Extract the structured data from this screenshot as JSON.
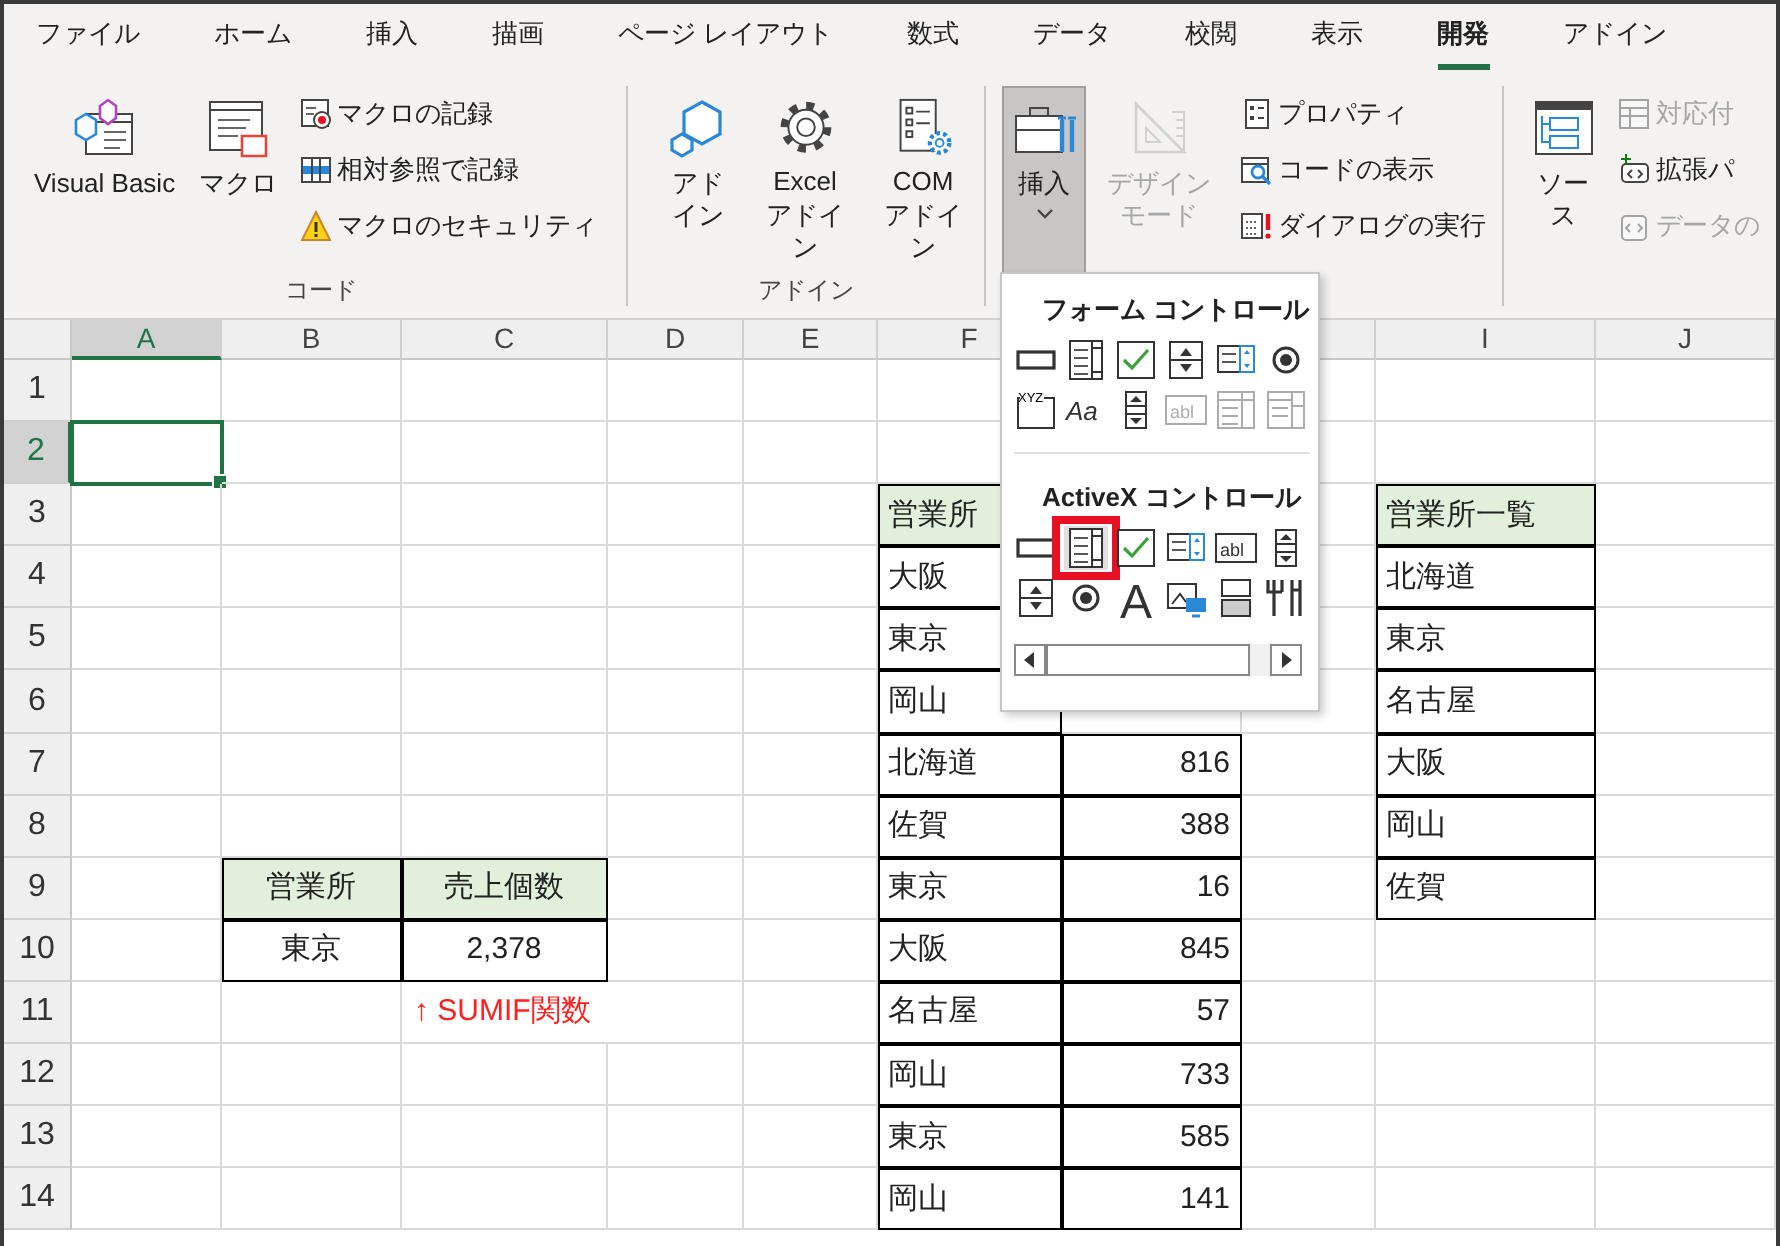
{
  "tabs": [
    {
      "label": "ファイル",
      "selected": false
    },
    {
      "label": "ホーム",
      "selected": false
    },
    {
      "label": "挿入",
      "selected": false
    },
    {
      "label": "描画",
      "selected": false
    },
    {
      "label": "ページ レイアウト",
      "selected": false
    },
    {
      "label": "数式",
      "selected": false
    },
    {
      "label": "データ",
      "selected": false
    },
    {
      "label": "校閲",
      "selected": false
    },
    {
      "label": "表示",
      "selected": false
    },
    {
      "label": "開発",
      "selected": true
    },
    {
      "label": "アドイン",
      "selected": false
    }
  ],
  "ribbon": {
    "groups": [
      {
        "label": "コード",
        "buttons": [
          {
            "kind": "large",
            "label": "Visual Basic",
            "pressed": false,
            "disabled": false,
            "dropdown": false
          },
          {
            "kind": "large",
            "label": "マクロ",
            "pressed": false,
            "disabled": false,
            "dropdown": false
          },
          {
            "kind": "small",
            "label": "マクロの記録",
            "pressed": false,
            "disabled": false
          },
          {
            "kind": "small",
            "label": "相対参照で記録",
            "pressed": false,
            "disabled": false
          },
          {
            "kind": "small",
            "label": "マクロのセキュリティ",
            "pressed": false,
            "disabled": false
          }
        ]
      },
      {
        "label": "アドイン",
        "buttons": [
          {
            "kind": "large",
            "label": "アドイン",
            "pressed": false,
            "disabled": false,
            "dropdown": false
          },
          {
            "kind": "large",
            "label": "Excel アドイン",
            "pressed": false,
            "disabled": false,
            "dropdown": false
          },
          {
            "kind": "large",
            "label": "COM アドイン",
            "pressed": false,
            "disabled": false,
            "dropdown": false
          }
        ]
      },
      {
        "buttons": [
          {
            "kind": "large",
            "label": "挿入",
            "pressed": true,
            "disabled": false,
            "dropdown": true
          },
          {
            "kind": "large",
            "label": "デザインモード",
            "pressed": false,
            "disabled": true,
            "dropdown": false
          },
          {
            "kind": "small",
            "label": "プロパティ",
            "pressed": false,
            "disabled": false
          },
          {
            "kind": "small",
            "label": "コードの表示",
            "pressed": false,
            "disabled": false
          },
          {
            "kind": "small",
            "label": "ダイアログの実行",
            "pressed": false,
            "disabled": false
          }
        ]
      },
      {
        "buttons": [
          {
            "kind": "large",
            "label": "ソース",
            "pressed": false,
            "disabled": false,
            "dropdown": false
          },
          {
            "kind": "small",
            "label": "対応付",
            "pressed": false,
            "disabled": true
          },
          {
            "kind": "small",
            "label": "拡張パ",
            "pressed": false,
            "disabled": false
          },
          {
            "kind": "small",
            "label": "データの",
            "pressed": false,
            "disabled": true
          }
        ]
      }
    ]
  },
  "insert_menu": {
    "sections": [
      {
        "title": "フォーム コントロール",
        "items": [
          {
            "kind": "button",
            "disabled": false,
            "highlighted": false
          },
          {
            "kind": "combobox",
            "disabled": false,
            "highlighted": false
          },
          {
            "kind": "checkbox",
            "disabled": false,
            "highlighted": false
          },
          {
            "kind": "spin",
            "disabled": false,
            "highlighted": false
          },
          {
            "kind": "listbox",
            "disabled": false,
            "highlighted": false
          },
          {
            "kind": "radio",
            "disabled": false,
            "highlighted": false
          },
          {
            "kind": "groupbox",
            "glyph": "XYZ",
            "disabled": false,
            "highlighted": false
          },
          {
            "kind": "label",
            "glyph": "Aa",
            "disabled": false,
            "highlighted": false
          },
          {
            "kind": "scrollbar",
            "disabled": false,
            "highlighted": false
          },
          {
            "kind": "textbox",
            "glyph": "abl",
            "disabled": true,
            "highlighted": false
          },
          {
            "kind": "combolist",
            "disabled": true,
            "highlighted": false
          },
          {
            "kind": "combodrop",
            "disabled": true,
            "highlighted": false
          }
        ]
      },
      {
        "title": "ActiveX コントロール",
        "items": [
          {
            "kind": "button",
            "disabled": false,
            "highlighted": false
          },
          {
            "kind": "combobox",
            "disabled": false,
            "highlighted": true
          },
          {
            "kind": "checkbox",
            "disabled": false,
            "highlighted": false
          },
          {
            "kind": "listbox",
            "disabled": false,
            "highlighted": false
          },
          {
            "kind": "textbox",
            "glyph": "abl",
            "disabled": false,
            "highlighted": false
          },
          {
            "kind": "scrollbar",
            "disabled": false,
            "highlighted": false
          },
          {
            "kind": "spin",
            "disabled": false,
            "highlighted": false
          },
          {
            "kind": "radio",
            "disabled": false,
            "highlighted": false
          },
          {
            "kind": "biglabel",
            "glyph": "A",
            "disabled": false,
            "highlighted": false
          },
          {
            "kind": "image",
            "disabled": false,
            "highlighted": false
          },
          {
            "kind": "toggle",
            "disabled": false,
            "highlighted": false
          },
          {
            "kind": "tools",
            "disabled": false,
            "highlighted": false
          }
        ]
      }
    ]
  },
  "sheet": {
    "columns": [
      {
        "label": "A",
        "selected": true
      },
      {
        "label": "B",
        "selected": false
      },
      {
        "label": "C",
        "selected": false
      },
      {
        "label": "D",
        "selected": false
      },
      {
        "label": "E",
        "selected": false
      },
      {
        "label": "F",
        "selected": false
      },
      null,
      null,
      {
        "label": "I",
        "selected": false
      },
      {
        "label": "J",
        "selected": false
      }
    ],
    "rows": [
      {
        "label": "1",
        "selected": false,
        "cells": []
      },
      {
        "label": "2",
        "selected": true,
        "cells": []
      },
      {
        "label": "3",
        "selected": false,
        "cells": [
          null,
          null,
          null,
          null,
          null,
          {
            "text": "営業所",
            "kind": "header"
          },
          null,
          null,
          {
            "text": "営業所一覧",
            "kind": "header"
          }
        ]
      },
      {
        "label": "4",
        "selected": false,
        "cells": [
          null,
          null,
          null,
          null,
          null,
          {
            "text": "大阪",
            "kind": "text"
          },
          null,
          null,
          {
            "text": "北海道",
            "kind": "text"
          }
        ]
      },
      {
        "label": "5",
        "selected": false,
        "cells": [
          null,
          null,
          null,
          null,
          null,
          {
            "text": "東京",
            "kind": "text"
          },
          null,
          null,
          {
            "text": "東京",
            "kind": "text"
          }
        ]
      },
      {
        "label": "6",
        "selected": false,
        "cells": [
          null,
          null,
          null,
          null,
          null,
          {
            "text": "岡山",
            "kind": "text"
          },
          null,
          null,
          {
            "text": "名古屋",
            "kind": "text"
          }
        ]
      },
      {
        "label": "7",
        "selected": false,
        "cells": [
          null,
          null,
          null,
          null,
          null,
          {
            "text": "北海道",
            "kind": "text"
          },
          {
            "text": "816",
            "kind": "number"
          },
          null,
          {
            "text": "大阪",
            "kind": "text"
          }
        ]
      },
      {
        "label": "8",
        "selected": false,
        "cells": [
          null,
          null,
          null,
          null,
          null,
          {
            "text": "佐賀",
            "kind": "text"
          },
          {
            "text": "388",
            "kind": "number"
          },
          null,
          {
            "text": "岡山",
            "kind": "text"
          }
        ]
      },
      {
        "label": "9",
        "selected": false,
        "cells": [
          null,
          {
            "text": "営業所",
            "kind": "header-center"
          },
          {
            "text": "売上個数",
            "kind": "header-center"
          },
          null,
          null,
          {
            "text": "東京",
            "kind": "text"
          },
          {
            "text": "16",
            "kind": "number"
          },
          null,
          {
            "text": "佐賀",
            "kind": "text"
          }
        ]
      },
      {
        "label": "10",
        "selected": false,
        "cells": [
          null,
          {
            "text": "東京",
            "kind": "text-center"
          },
          {
            "text": "2,378",
            "kind": "text-center"
          },
          null,
          null,
          {
            "text": "大阪",
            "kind": "text"
          },
          {
            "text": "845",
            "kind": "number"
          }
        ]
      },
      {
        "label": "11",
        "selected": false,
        "cells": [
          null,
          null,
          {
            "text": "↑ SUMIF関数",
            "kind": "note"
          },
          null,
          null,
          {
            "text": "名古屋",
            "kind": "text"
          },
          {
            "text": "57",
            "kind": "number"
          }
        ]
      },
      {
        "label": "12",
        "selected": false,
        "cells": [
          null,
          null,
          null,
          null,
          null,
          {
            "text": "岡山",
            "kind": "text"
          },
          {
            "text": "733",
            "kind": "number"
          }
        ]
      },
      {
        "label": "13",
        "selected": false,
        "cells": [
          null,
          null,
          null,
          null,
          null,
          {
            "text": "東京",
            "kind": "text"
          },
          {
            "text": "585",
            "kind": "number"
          }
        ]
      },
      {
        "label": "14",
        "selected": false,
        "cells": [
          null,
          null,
          null,
          null,
          null,
          {
            "text": "岡山",
            "kind": "text"
          },
          {
            "text": "141",
            "kind": "number"
          }
        ]
      }
    ]
  }
}
